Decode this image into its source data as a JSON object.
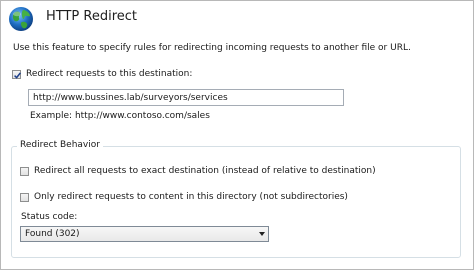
{
  "header": {
    "title": "HTTP Redirect",
    "icon": "globe-icon"
  },
  "description": "Use this feature to specify rules for redirecting incoming requests to another file or URL.",
  "redirect": {
    "checkbox_label": "Redirect requests to this destination:",
    "checked": true,
    "destination_value": "http://www.bussines.lab/surveyors/services",
    "example": "Example: http://www.contoso.com/sales"
  },
  "behavior": {
    "group_label": "Redirect Behavior",
    "exact_destination_label": "Redirect all requests to exact destination (instead of relative to destination)",
    "exact_destination_checked": false,
    "directory_only_label": "Only redirect requests to content in this directory (not subdirectories)",
    "directory_only_checked": false,
    "status_code_label": "Status code:",
    "status_code_value": "Found (302)"
  },
  "colors": {
    "globe_ocean": "#1f6fc4",
    "globe_land": "#3aa23a",
    "group_border": "#d5dfe5"
  }
}
